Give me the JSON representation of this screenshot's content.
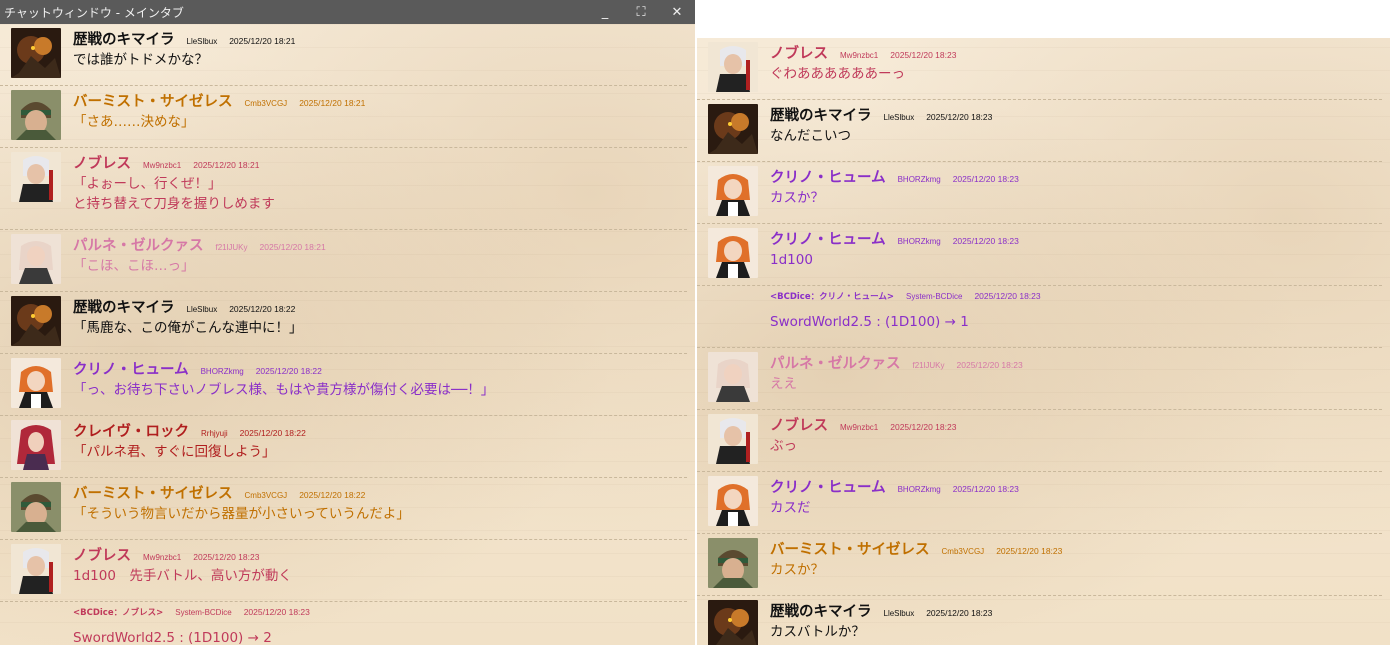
{
  "window": {
    "title": "チャットウィンドウ - メインタブ",
    "controls": {
      "minimize": "_",
      "maximize": "⛶",
      "close": "✕"
    }
  },
  "colors": {
    "black": "#111111",
    "orange": "#c07000",
    "pink": "#c03a5a",
    "lightpink": "#d678a6",
    "purple": "#8a2fc8",
    "red": "#b01e1e"
  },
  "left_messages": [
    {
      "avatar": "chimera",
      "name": "歴戦のキマイラ",
      "uid": "LleSlbux",
      "time": "2025/12/20 18:21",
      "color": "black",
      "lines": [
        "では誰がトドメかな？"
      ]
    },
    {
      "avatar": "bermist",
      "name": "バーミスト・サイゼレス",
      "uid": "Cmb3VCGJ",
      "time": "2025/12/20 18:21",
      "color": "orange",
      "lines": [
        "「さあ……決めな」"
      ]
    },
    {
      "avatar": "noblesse",
      "name": "ノブレス",
      "uid": "Mw9nzbc1",
      "time": "2025/12/20 18:21",
      "color": "pink",
      "lines": [
        "「よぉーし、行くぜ！」",
        "と持ち替えて刀身を握りしめます"
      ]
    },
    {
      "avatar": "parune",
      "name": "パルネ・ゼルクァス",
      "uid": "f21lJUKy",
      "time": "2025/12/20 18:21",
      "color": "lightpink",
      "lines": [
        "「こほ、こほ…っ」"
      ]
    },
    {
      "avatar": "chimera",
      "name": "歴戦のキマイラ",
      "uid": "LleSlbux",
      "time": "2025/12/20 18:22",
      "color": "black",
      "lines": [
        "「馬鹿な、この俺がこんな連中に！」"
      ]
    },
    {
      "avatar": "kurino",
      "name": "クリノ・ヒューム",
      "uid": "BHORZkmg",
      "time": "2025/12/20 18:22",
      "color": "purple",
      "lines": [
        "「っ、お待ち下さいノブレス様、もはや貴方様が傷付く必要は──！」"
      ]
    },
    {
      "avatar": "cleive",
      "name": "クレイヴ・ロック",
      "uid": "Rrhjyuji",
      "time": "2025/12/20 18:22",
      "color": "red",
      "lines": [
        "「パルネ君、すぐに回復しよう」"
      ]
    },
    {
      "avatar": "bermist",
      "name": "バーミスト・サイゼレス",
      "uid": "Cmb3VCGJ",
      "time": "2025/12/20 18:22",
      "color": "orange",
      "lines": [
        "「そういう物言いだから器量が小さいっていうんだよ」"
      ]
    },
    {
      "avatar": "noblesse",
      "name": "ノブレス",
      "uid": "Mw9nzbc1",
      "time": "2025/12/20 18:23",
      "color": "pink",
      "lines": [
        "1d100　先手バトル、高い方が動く"
      ]
    },
    {
      "system": true,
      "name": "<BCDice：ノブレス>",
      "uid": "System-BCDice",
      "time": "2025/12/20 18:23",
      "color": "pink",
      "lines": [
        "SwordWorld2.5 : (1D100) → 2"
      ]
    }
  ],
  "right_messages": [
    {
      "avatar": "noblesse",
      "name": "ノブレス",
      "uid": "Mw9nzbc1",
      "time": "2025/12/20 18:23",
      "color": "pink",
      "lines": [
        "ぐわああああああーっ"
      ]
    },
    {
      "avatar": "chimera",
      "name": "歴戦のキマイラ",
      "uid": "LleSlbux",
      "time": "2025/12/20 18:23",
      "color": "black",
      "lines": [
        "なんだこいつ"
      ]
    },
    {
      "avatar": "kurino",
      "name": "クリノ・ヒューム",
      "uid": "BHORZkmg",
      "time": "2025/12/20 18:23",
      "color": "purple",
      "lines": [
        "カスか？"
      ]
    },
    {
      "avatar": "kurino",
      "name": "クリノ・ヒューム",
      "uid": "BHORZkmg",
      "time": "2025/12/20 18:23",
      "color": "purple",
      "lines": [
        "1d100"
      ]
    },
    {
      "system": true,
      "name": "<BCDice：クリノ・ヒューム>",
      "uid": "System-BCDice",
      "time": "2025/12/20 18:23",
      "color": "purple",
      "lines": [
        "SwordWorld2.5 : (1D100) → 1"
      ]
    },
    {
      "avatar": "parune",
      "name": "パルネ・ゼルクァス",
      "uid": "f21lJUKy",
      "time": "2025/12/20 18:23",
      "color": "lightpink",
      "lines": [
        "ええ"
      ]
    },
    {
      "avatar": "noblesse",
      "name": "ノブレス",
      "uid": "Mw9nzbc1",
      "time": "2025/12/20 18:23",
      "color": "pink",
      "lines": [
        "ぶっ"
      ]
    },
    {
      "avatar": "kurino",
      "name": "クリノ・ヒューム",
      "uid": "BHORZkmg",
      "time": "2025/12/20 18:23",
      "color": "purple",
      "lines": [
        "カスだ"
      ]
    },
    {
      "avatar": "bermist",
      "name": "バーミスト・サイゼレス",
      "uid": "Cmb3VCGJ",
      "time": "2025/12/20 18:23",
      "color": "orange",
      "lines": [
        "カスか？"
      ]
    },
    {
      "avatar": "chimera",
      "name": "歴戦のキマイラ",
      "uid": "LleSlbux",
      "time": "2025/12/20 18:23",
      "color": "black",
      "lines": [
        "カスバトルか？"
      ]
    }
  ]
}
